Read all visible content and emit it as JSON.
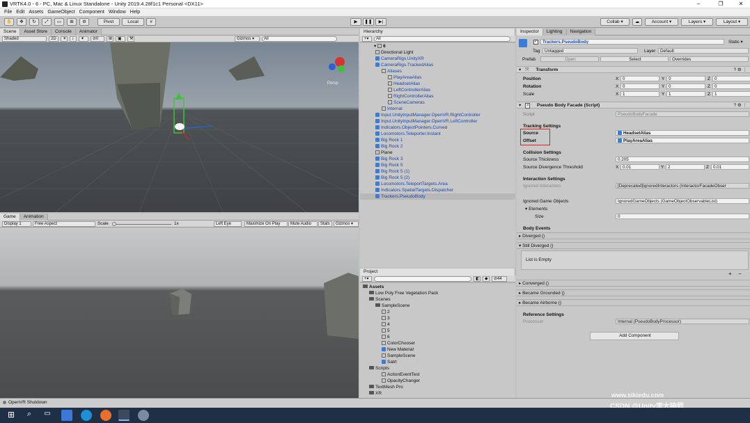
{
  "window": {
    "title": "VRTK4.0 - 6 - PC, Mac & Linux Standalone - Unity 2019.4.28f1c1 Personal <DX11>"
  },
  "menu": [
    "File",
    "Edit",
    "Assets",
    "GameObject",
    "Component",
    "Window",
    "Help"
  ],
  "toolbar": {
    "pivot": "Pivot",
    "local": "Local",
    "collab": "Collab ▾",
    "account": "Account ▾",
    "layers": "Layers ▾",
    "layout": "Layout ▾"
  },
  "scene": {
    "tabs": [
      "Scene",
      "Asset Store",
      "Console",
      "Animator"
    ],
    "shading": "Shaded",
    "mode2d": "2D",
    "gizmos": "Gizmos ▾",
    "search": "All",
    "persp": "Persp"
  },
  "game": {
    "tabs": [
      "Game",
      "Animation"
    ],
    "display": "Display 1",
    "aspect": "Free Aspect",
    "scale_label": "Scale",
    "scale_value": "1x",
    "eye": "Left Eye",
    "max": "Maximize On Play",
    "mute": "Mute Audio",
    "stats": "Stats",
    "gizmos": "Gizmos ▾"
  },
  "hierarchy": {
    "tab": "Hierarchy",
    "search": "All",
    "scene": "6",
    "items": [
      {
        "label": "Directional Light",
        "indent": 2,
        "blue": false,
        "icon": "go"
      },
      {
        "label": "CameraRigs.UnityXR",
        "indent": 2,
        "blue": true,
        "icon": "cube"
      },
      {
        "label": "CameraRigs.TrackedAlias",
        "indent": 2,
        "blue": true,
        "icon": "cube"
      },
      {
        "label": "Aliases",
        "indent": 3,
        "blue": true,
        "icon": "go"
      },
      {
        "label": "PlayAreaAlias",
        "indent": 4,
        "blue": true,
        "icon": "go"
      },
      {
        "label": "HeadsetAlias",
        "indent": 4,
        "blue": true,
        "icon": "go"
      },
      {
        "label": "LeftControllerAlias",
        "indent": 4,
        "blue": true,
        "icon": "go"
      },
      {
        "label": "RightControllerAlias",
        "indent": 4,
        "blue": true,
        "icon": "go"
      },
      {
        "label": "SceneCameras",
        "indent": 4,
        "blue": true,
        "icon": "go"
      },
      {
        "label": "Internal",
        "indent": 3,
        "blue": true,
        "icon": "go"
      },
      {
        "label": "Input.UnityInputManager.OpenVR.RightController",
        "indent": 2,
        "blue": true,
        "icon": "cube"
      },
      {
        "label": "Input.UnityInputManager.OpenVR.LeftController",
        "indent": 2,
        "blue": true,
        "icon": "cube"
      },
      {
        "label": "Indicators.ObjectPointers.Curved",
        "indent": 2,
        "blue": true,
        "icon": "cube"
      },
      {
        "label": "Locomotors.Teleporter.Instant",
        "indent": 2,
        "blue": true,
        "icon": "cube"
      },
      {
        "label": "Big Rock 1",
        "indent": 2,
        "blue": true,
        "icon": "cube"
      },
      {
        "label": "Big Rock 2",
        "indent": 2,
        "blue": true,
        "icon": "cube"
      },
      {
        "label": "Plane",
        "indent": 2,
        "blue": false,
        "icon": "go"
      },
      {
        "label": "Big Rock 3",
        "indent": 2,
        "blue": true,
        "icon": "cube"
      },
      {
        "label": "Big Rock 5",
        "indent": 2,
        "blue": true,
        "icon": "cube"
      },
      {
        "label": "Big Rock 5 (1)",
        "indent": 2,
        "blue": true,
        "icon": "cube"
      },
      {
        "label": "Big Rock 5 (2)",
        "indent": 2,
        "blue": true,
        "icon": "cube"
      },
      {
        "label": "Locomotors.TeleportTargets.Area",
        "indent": 2,
        "blue": true,
        "icon": "cube"
      },
      {
        "label": "Indicators.SpatialTargets.Dispatcher",
        "indent": 2,
        "blue": true,
        "icon": "cube"
      },
      {
        "label": "Trackers.PseudoBody",
        "indent": 2,
        "blue": true,
        "icon": "cube"
      }
    ]
  },
  "project": {
    "tab": "Project",
    "count": "44",
    "items": [
      {
        "label": "Assets",
        "indent": 0,
        "bold": true,
        "icon": "folder"
      },
      {
        "label": "Low Poly Free Vegetation Pack",
        "indent": 1,
        "icon": "folder"
      },
      {
        "label": "Scenes",
        "indent": 1,
        "icon": "folder"
      },
      {
        "label": "SampleScene",
        "indent": 2,
        "icon": "folder"
      },
      {
        "label": "2",
        "indent": 3,
        "icon": "go"
      },
      {
        "label": "3",
        "indent": 3,
        "icon": "go"
      },
      {
        "label": "4",
        "indent": 3,
        "icon": "go"
      },
      {
        "label": "5",
        "indent": 3,
        "icon": "go"
      },
      {
        "label": "6",
        "indent": 3,
        "icon": "go"
      },
      {
        "label": "ColorChooser",
        "indent": 3,
        "icon": "go"
      },
      {
        "label": "New Material",
        "indent": 3,
        "icon": "cube"
      },
      {
        "label": "SampleScene",
        "indent": 3,
        "icon": "go"
      },
      {
        "label": "Satrt",
        "indent": 3,
        "icon": "cube"
      },
      {
        "label": "Scripts",
        "indent": 1,
        "icon": "folder"
      },
      {
        "label": "ActionEventTest",
        "indent": 3,
        "icon": "go"
      },
      {
        "label": "OpacityChanger",
        "indent": 3,
        "icon": "go"
      },
      {
        "label": "TextMesh Pro",
        "indent": 1,
        "icon": "folder"
      },
      {
        "label": "XR",
        "indent": 1,
        "icon": "folder"
      }
    ]
  },
  "inspector": {
    "tabs": [
      "Inspector",
      "Lighting",
      "Navigation"
    ],
    "object_name": "Trackers.PseudoBody",
    "static": "Static ▾",
    "tag_label": "Tag",
    "tag": "Untagged",
    "layer_label": "Layer",
    "layer": "Default",
    "prefab_label": "Prefab",
    "open": "Open",
    "select": "Select",
    "overrides": "Overrides",
    "transform": {
      "title": "Transform",
      "position": "Position",
      "rotation": "Rotation",
      "scale": "Scale",
      "pos": [
        "0",
        "0",
        "0"
      ],
      "rot": [
        "0",
        "0",
        "0"
      ],
      "scl": [
        "1",
        "1",
        "1"
      ]
    },
    "facade": {
      "title": "Pseudo Body Facade (Script)",
      "script_label": "Script",
      "script": "PseudoBodyFacade",
      "tracking": "Tracking Settings",
      "source_label": "Source",
      "source": "HeadsetAlias",
      "offset_label": "Offset",
      "offset": "PlayAreaAlias",
      "collision": "Collision Settings",
      "thickness_label": "Source Thickness",
      "thickness": "0.205",
      "divergence_label": "Source Divergence Threshold",
      "div": [
        "0.01",
        "2",
        "0.01"
      ],
      "interaction": "Interaction Settings",
      "ignored_interactors_label": "Ignored Interactors",
      "ignored_interactors": "[Deprecated]IgnoredInteractors (InteractorFacadeObser",
      "ignored_go_label": "Ignored Game Objects",
      "ignored_go": "IgnoredGameObjects (GameObjectObservableList)",
      "elements": "Elements",
      "size_label": "Size",
      "size": "0",
      "body_events": "Body Events",
      "diverged": "Diverged ()",
      "still_diverged": "Still Diverged ()",
      "list_empty": "List is Empty",
      "converged": "Converged ()",
      "grounded": "Became Grounded ()",
      "airborne": "Became Airborne ()",
      "reference": "Reference Settings",
      "processor_label": "Processor",
      "processor": "Internal (PseudoBodyProcessor)"
    },
    "add_component": "Add Component"
  },
  "status": "OpenVR Shutdown",
  "watermark": {
    "site": "www.sikiedu.com",
    "csdn": "CSDN @Unity李大响师"
  }
}
